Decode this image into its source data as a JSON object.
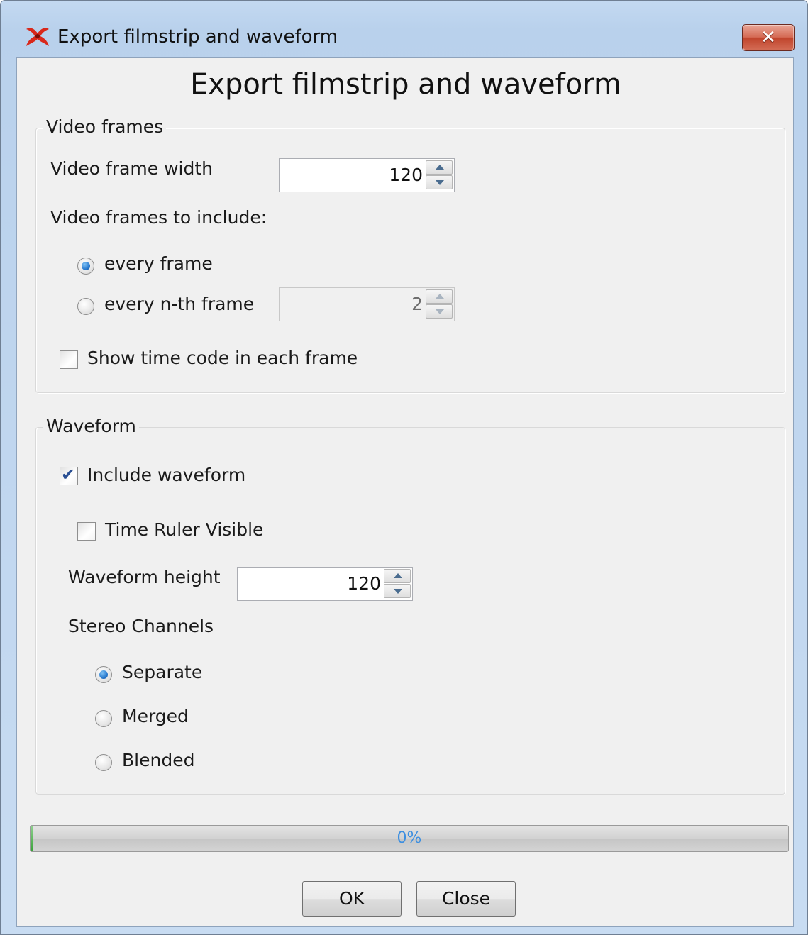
{
  "window": {
    "title": "Export filmstrip and waveform",
    "close_icon": "close-x-icon",
    "app_icon": "app-logo-icon"
  },
  "dialog": {
    "heading": "Export filmstrip and waveform",
    "video": {
      "group_title": "Video frames",
      "frame_width_label": "Video frame width",
      "frame_width_value": "120",
      "frames_include_label": "Video frames to include:",
      "every_frame_label": "every frame",
      "every_frame_checked": true,
      "every_nth_label": "every n-th frame",
      "every_nth_checked": false,
      "nth_value": "2",
      "show_timecode_label": "Show time code in each frame",
      "show_timecode_checked": false
    },
    "waveform": {
      "group_title": "Waveform",
      "include_label": "Include waveform",
      "include_checked": true,
      "time_ruler_label": "Time Ruler Visible",
      "time_ruler_checked": false,
      "height_label": "Waveform height",
      "height_value": "120",
      "stereo_label": "Stereo Channels",
      "separate_label": "Separate",
      "separate_checked": true,
      "merged_label": "Merged",
      "merged_checked": false,
      "blended_label": "Blended",
      "blended_checked": false
    },
    "progress": {
      "text": "0%",
      "value": 0
    },
    "buttons": {
      "ok": "OK",
      "close": "Close"
    }
  },
  "colors": {
    "title_bar": "#c3d9f1",
    "close_button": "#c0442c",
    "progress_text": "#3d8fe0",
    "radio_selected": "#2a7bcf",
    "checkmark": "#2a4f93"
  }
}
